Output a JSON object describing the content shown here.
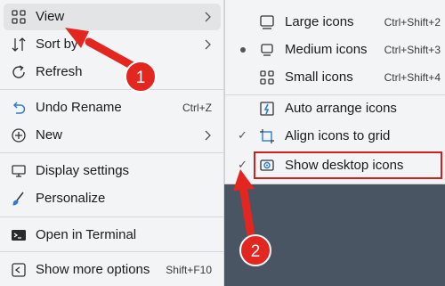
{
  "main_menu": {
    "items": [
      {
        "label": "View",
        "shortcut": "",
        "submenu": true
      },
      {
        "label": "Sort by",
        "shortcut": "",
        "submenu": true
      },
      {
        "label": "Refresh",
        "shortcut": "",
        "submenu": false
      },
      {
        "label": "Undo Rename",
        "shortcut": "Ctrl+Z",
        "submenu": false
      },
      {
        "label": "New",
        "shortcut": "",
        "submenu": true
      },
      {
        "label": "Display settings",
        "shortcut": "",
        "submenu": false
      },
      {
        "label": "Personalize",
        "shortcut": "",
        "submenu": false
      },
      {
        "label": "Open in Terminal",
        "shortcut": "",
        "submenu": false
      },
      {
        "label": "Show more options",
        "shortcut": "Shift+F10",
        "submenu": false
      }
    ]
  },
  "view_submenu": {
    "items": [
      {
        "label": "Large icons",
        "shortcut": "Ctrl+Shift+2",
        "mark": "none"
      },
      {
        "label": "Medium icons",
        "shortcut": "Ctrl+Shift+3",
        "mark": "bullet"
      },
      {
        "label": "Small icons",
        "shortcut": "Ctrl+Shift+4",
        "mark": "none"
      },
      {
        "label": "Auto arrange icons",
        "shortcut": "",
        "mark": "none"
      },
      {
        "label": "Align icons to grid",
        "shortcut": "",
        "mark": "check"
      },
      {
        "label": "Show desktop icons",
        "shortcut": "",
        "mark": "check"
      }
    ]
  },
  "annotations": {
    "badge_1": "1",
    "badge_2": "2",
    "color": "#e3261f"
  }
}
